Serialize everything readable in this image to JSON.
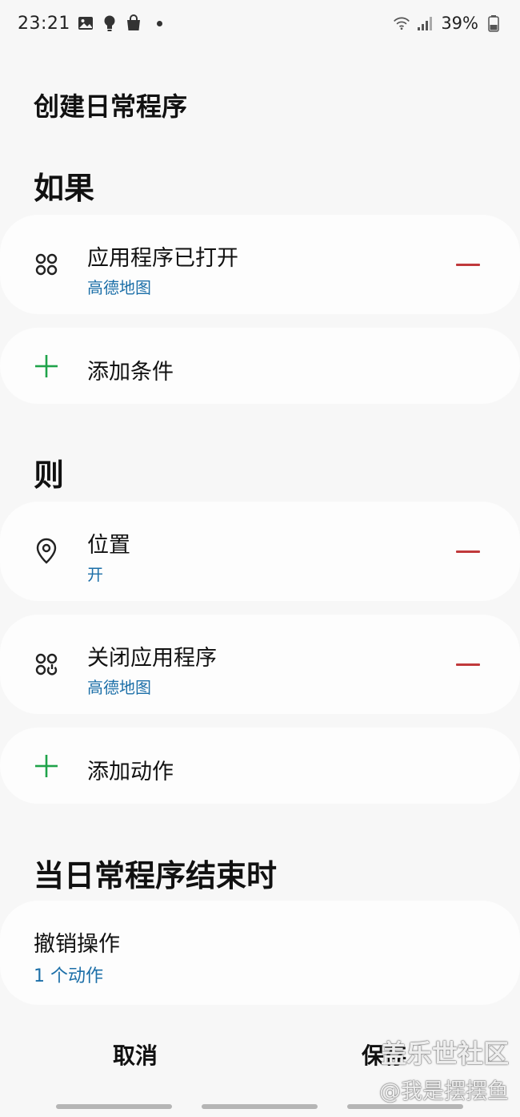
{
  "status_bar": {
    "time": "23:21",
    "battery": "39%",
    "icons_left": [
      "gallery-icon",
      "bulb-icon",
      "shopping-bag-icon",
      "dot-icon"
    ],
    "icons_right": [
      "wifi-icon",
      "signal-icon",
      "battery-icon"
    ]
  },
  "page": {
    "title": "创建日常程序"
  },
  "if_section": {
    "title": "如果",
    "conditions": [
      {
        "title": "应用程序已打开",
        "subtitle": "高德地图",
        "icon": "apps-icon"
      }
    ],
    "add_label": "添加条件"
  },
  "then_section": {
    "title": "则",
    "actions": [
      {
        "title": "位置",
        "subtitle": "开",
        "icon": "location-pin-icon"
      },
      {
        "title": "关闭应用程序",
        "subtitle": "高德地图",
        "icon": "close-apps-icon"
      }
    ],
    "add_label": "添加动作"
  },
  "end_section": {
    "title": "当日常程序结束时",
    "undo": {
      "title": "撤销操作",
      "subtitle": "1 个动作"
    }
  },
  "footer": {
    "cancel_label": "取消",
    "save_label": "保存"
  },
  "watermark": {
    "line1": "盖乐世社区",
    "line2": "@我是摆摆鱼"
  },
  "colors": {
    "background": "#f7f7f7",
    "card": "#fdfdfd",
    "accent_blue": "#1c6fa8",
    "add_green": "#1fa34a",
    "remove_red": "#c0393b"
  }
}
